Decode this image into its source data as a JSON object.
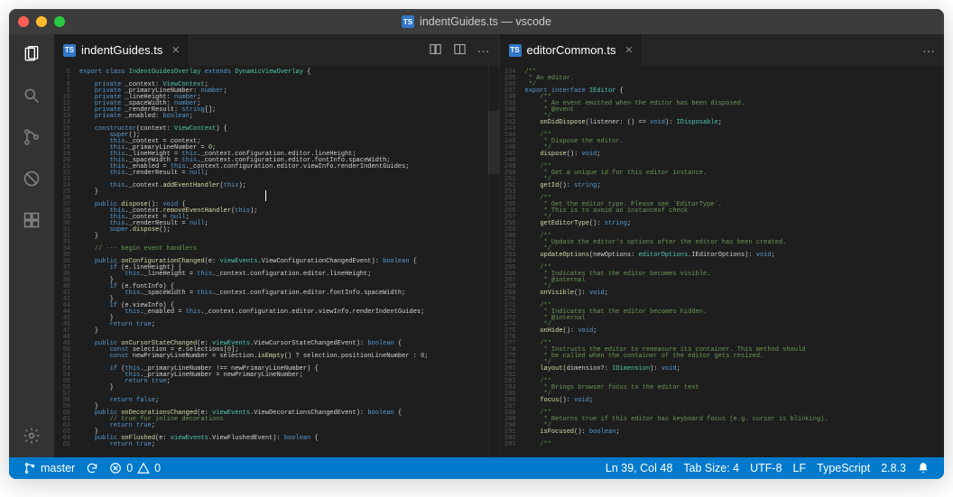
{
  "window": {
    "title": "indentGuides.ts — vscode"
  },
  "activity_bar": {
    "items": [
      "files-icon",
      "search-icon",
      "source-control-icon",
      "debug-icon",
      "extensions-icon"
    ],
    "bottom": [
      "settings-icon"
    ]
  },
  "panes": [
    {
      "tab": {
        "icon": "TS",
        "label": "indentGuides.ts",
        "dirty": false
      },
      "actions": [
        "diff-icon",
        "split-editor-icon",
        "more-icon"
      ],
      "gutter_start": 6,
      "lines": [
        "export class IndentGuidesOverlay extends DynamicViewOverlay {",
        "",
        "    private _context: ViewContext;",
        "    private _primaryLineNumber: number;",
        "    private _lineHeight: number;",
        "    private _spaceWidth: number;",
        "    private _renderResult: string[];",
        "    private _enabled: boolean;",
        "",
        "    constructor(context: ViewContext) {",
        "        super();",
        "        this._context = context;",
        "        this._primaryLineNumber = 0;",
        "        this._lineHeight = this._context.configuration.editor.lineHeight;",
        "        this._spaceWidth = this._context.configuration.editor.fontInfo.spaceWidth;",
        "        this._enabled = this._context.configuration.editor.viewInfo.renderIndentGuides;",
        "        this._renderResult = null;",
        "",
        "        this._context.addEventHandler(this);",
        "    }",
        "",
        "    public dispose(): void {",
        "        this._context.removeEventHandler(this);",
        "        this._context = null;",
        "        this._renderResult = null;",
        "        super.dispose();",
        "    }",
        "",
        "    // --- begin event handlers",
        "",
        "    public onConfigurationChanged(e: viewEvents.ViewConfigurationChangedEvent): boolean {",
        "        if (e.lineHeight) {",
        "            this._lineHeight = this._context.configuration.editor.lineHeight;",
        "        }",
        "        if (e.fontInfo) {",
        "            this._spaceWidth = this._context.configuration.editor.fontInfo.spaceWidth;",
        "        }",
        "        if (e.viewInfo) {",
        "            this._enabled = this._context.configuration.editor.viewInfo.renderIndentGuides;",
        "        }",
        "        return true;",
        "    }",
        "",
        "    public onCursorStateChanged(e: viewEvents.ViewCursorStateChangedEvent): boolean {",
        "        const selection = e.selections[0];",
        "        const newPrimaryLineNumber = selection.isEmpty() ? selection.positionLineNumber : 0;",
        "",
        "        if (this._primaryLineNumber !== newPrimaryLineNumber) {",
        "            this._primaryLineNumber = newPrimaryLineNumber;",
        "            return true;",
        "        }",
        "",
        "        return false;",
        "    }",
        "    public onDecorationsChanged(e: viewEvents.ViewDecorationsChangedEvent): boolean {",
        "        // true for inline decorations",
        "        return true;",
        "    }",
        "    public onFlushed(e: viewEvents.ViewFlushedEvent): boolean {",
        "        return true;"
      ]
    },
    {
      "tab": {
        "icon": "TS",
        "label": "editorCommon.ts",
        "dirty": false
      },
      "actions": [
        "more-icon"
      ],
      "gutter_start": 234,
      "lines": [
        "/**",
        " * An editor.",
        " */",
        "export interface IEditor {",
        "    /**",
        "     * An event emitted when the editor has been disposed.",
        "     * @event",
        "     */",
        "    onDidDispose(listener: () => void): IDisposable;",
        "",
        "    /**",
        "     * Dispose the editor.",
        "     */",
        "    dispose(): void;",
        "",
        "    /**",
        "     * Get a unique id for this editor instance.",
        "     */",
        "    getId(): string;",
        "",
        "    /**",
        "     * Get the editor type. Please see `EditorType`.",
        "     * This is to avoid an instanceof check",
        "     */",
        "    getEditorType(): string;",
        "",
        "    /**",
        "     * Update the editor's options after the editor has been created.",
        "     */",
        "    updateOptions(newOptions: editorOptions.IEditorOptions): void;",
        "",
        "    /**",
        "     * Indicates that the editor becomes visible.",
        "     * @internal",
        "     */",
        "    onVisible(): void;",
        "",
        "    /**",
        "     * Indicates that the editor becomes hidden.",
        "     * @internal",
        "     */",
        "    onHide(): void;",
        "",
        "    /**",
        "     * Instructs the editor to remeasure its container. This method should",
        "     * be called when the container of the editor gets resized.",
        "     */",
        "    layout(dimension?: IDimension): void;",
        "",
        "    /**",
        "     * Brings browser focus to the editor text",
        "     */",
        "    focus(): void;",
        "",
        "    /**",
        "     * Returns true if this editor has keyboard focus (e.g. cursor is blinking).",
        "     */",
        "    isFocused(): boolean;",
        "",
        "    /**"
      ]
    }
  ],
  "status": {
    "branch": "master",
    "errors": "0",
    "warnings": "0",
    "position": "Ln 39, Col 48",
    "tab_size": "Tab Size: 4",
    "encoding": "UTF-8",
    "eol": "LF",
    "language": "TypeScript",
    "version": "2.8.3"
  },
  "colors": {
    "statusbar": "#007acc",
    "editor_bg": "#1e1e1e"
  }
}
